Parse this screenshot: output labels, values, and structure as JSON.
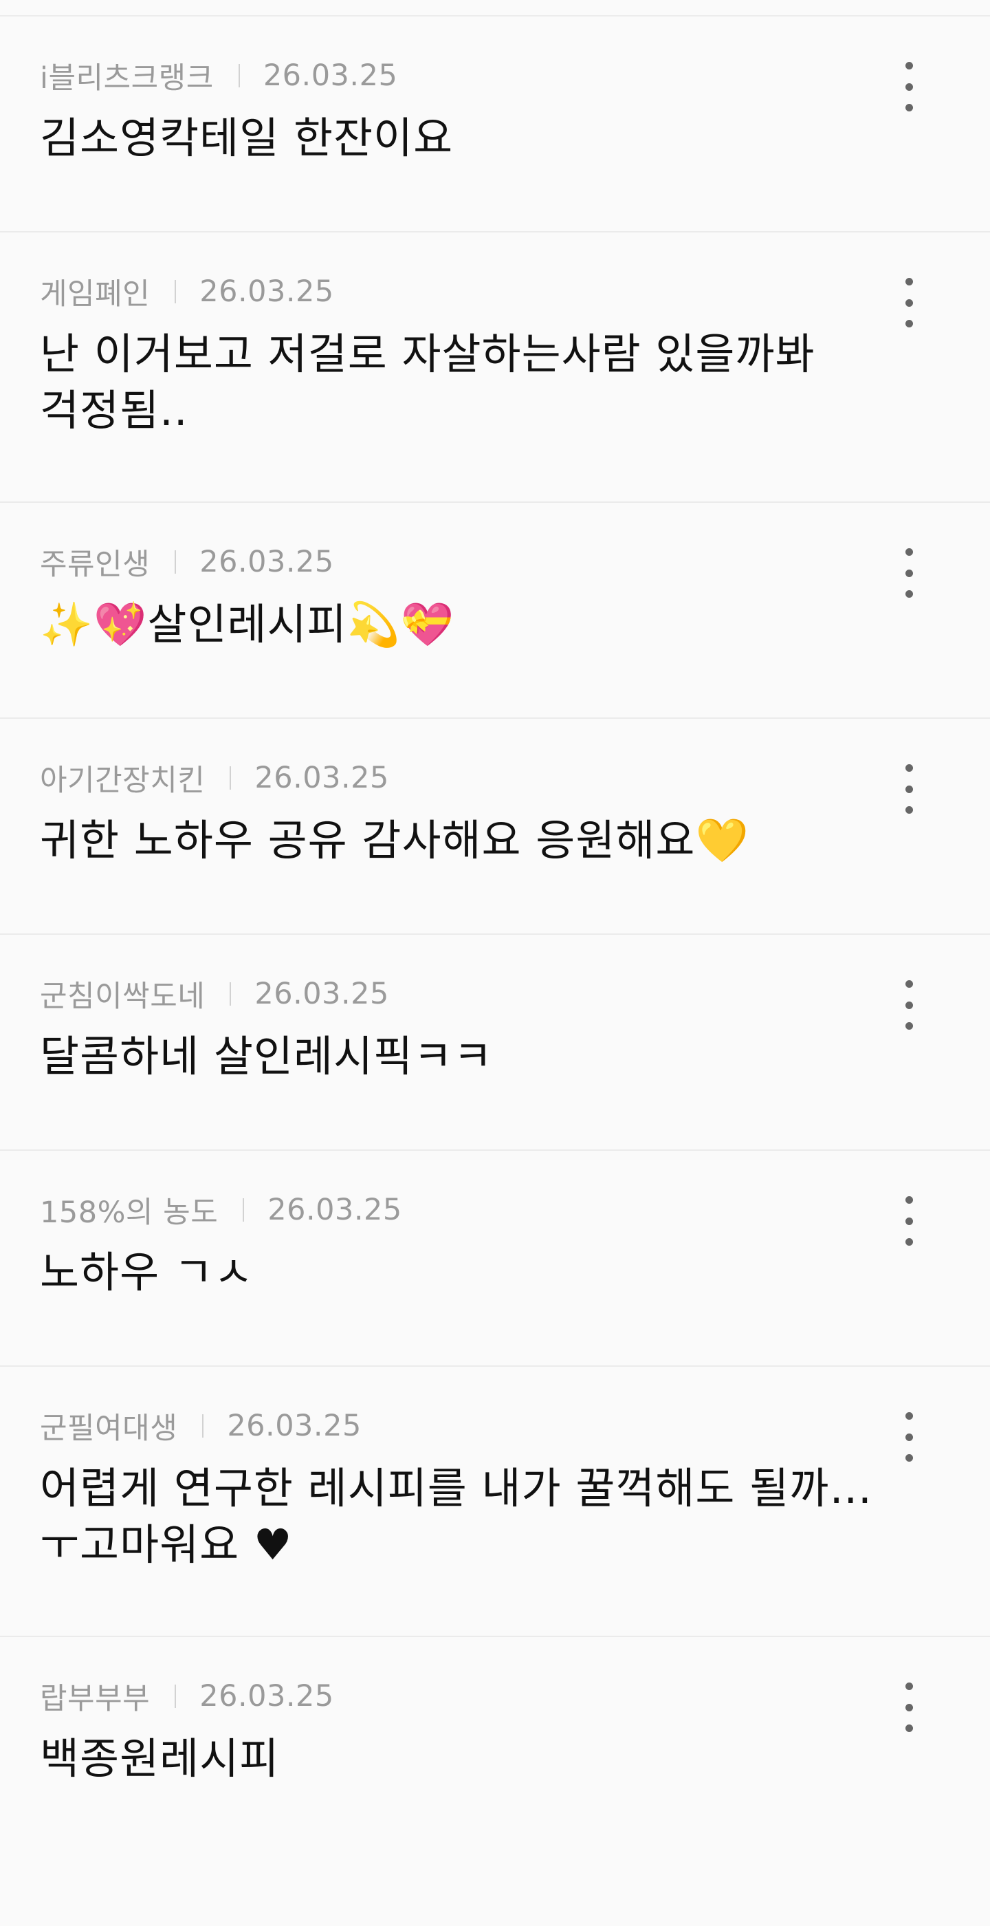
{
  "comments": [
    {
      "author": "i블리츠크랭크",
      "date": "26.03.25",
      "text": "김소영칵테일 한잔이요"
    },
    {
      "author": "게임폐인",
      "date": "26.03.25",
      "text": "난 이거보고 저걸로 자살하는사람 있을까봐 걱정됨.."
    },
    {
      "author": "주류인생",
      "date": "26.03.25",
      "text_parts": {
        "emoji_1": "✨",
        "emoji_2": "💖",
        "text": "살인레시피",
        "emoji_3": "💫",
        "emoji_4": "💝"
      }
    },
    {
      "author": "아기간장치킨",
      "date": "26.03.25",
      "text": "귀한 노하우 공유 감사해요 응원해요",
      "emoji": "💛"
    },
    {
      "author": "군침이싹도네",
      "date": "26.03.25",
      "text": "달콤하네 살인레시픽ㅋㅋ"
    },
    {
      "author": "158%의 농도",
      "date": "26.03.25",
      "text": "노하우 ㄱㅅ"
    },
    {
      "author": "군필여대생",
      "date": "26.03.25",
      "text": "어렵게 연구한 레시피를 내가 꿀꺽해도 될까… ㅜ고마워요 ♥"
    },
    {
      "author": "랍부부부",
      "date": "26.03.25",
      "text": "백종원레시피"
    }
  ],
  "icons": {
    "more": "more-vertical-icon"
  },
  "colors": {
    "background": "#fafafa",
    "meta_text": "#9a9a9a",
    "body_text": "#111111",
    "divider": "#ebebeb"
  }
}
